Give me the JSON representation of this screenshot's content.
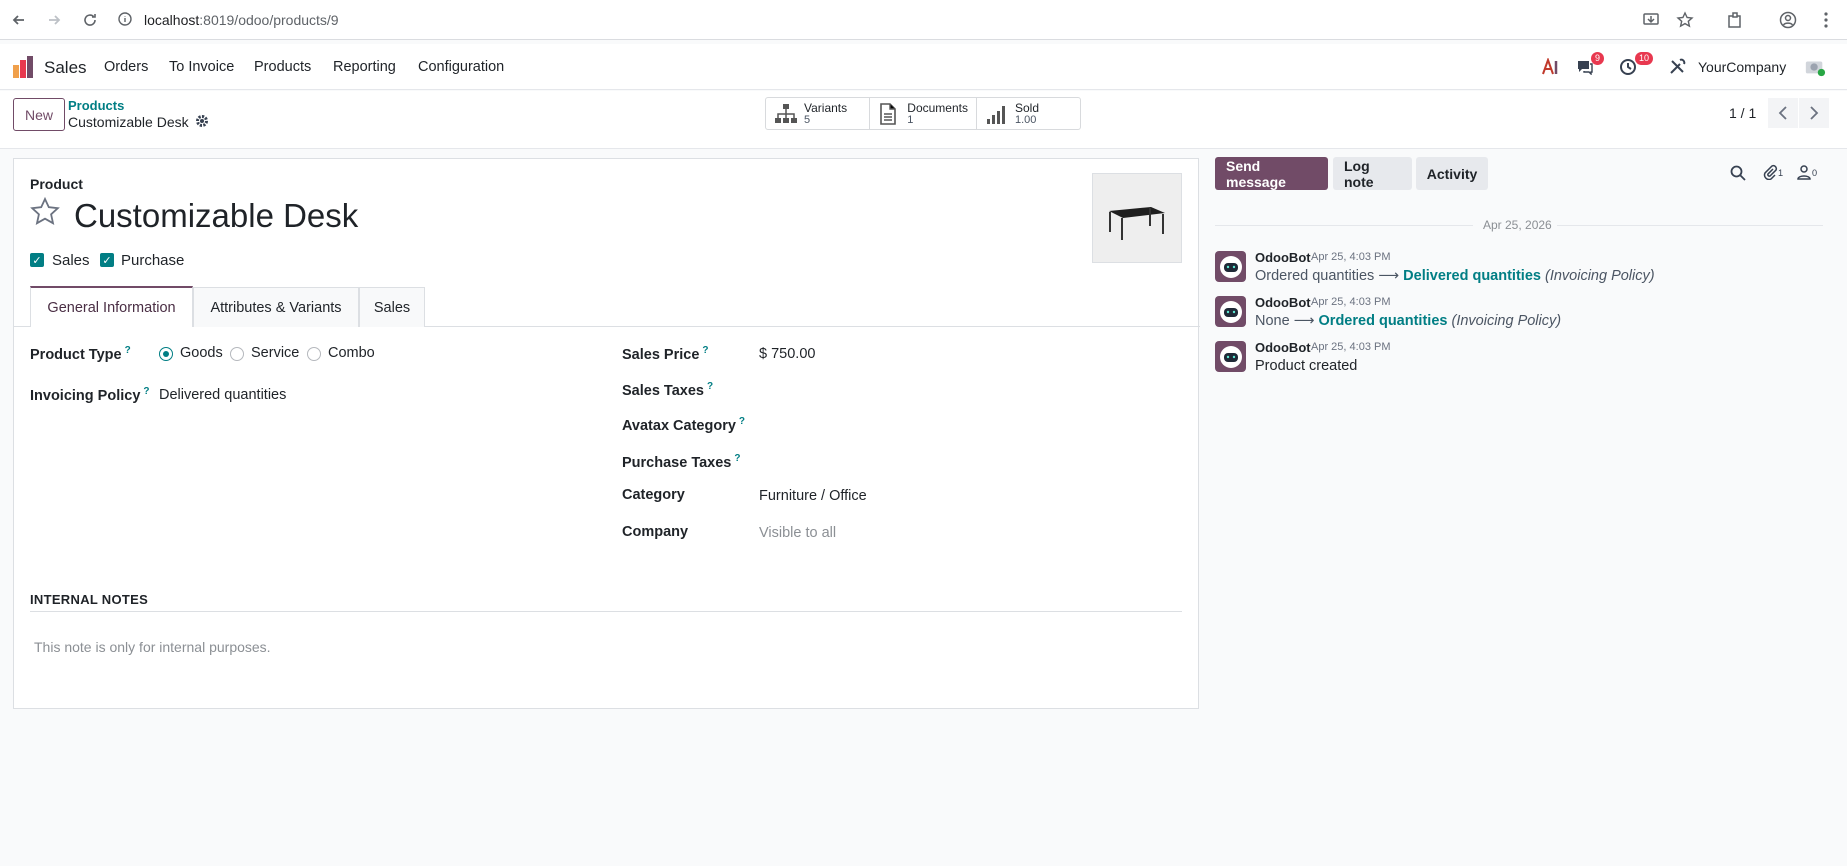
{
  "browser": {
    "url_host": "localhost",
    "url_rest": ":8019/odoo/products/9"
  },
  "navbar": {
    "app_name": "Sales",
    "menu": [
      "Orders",
      "To Invoice",
      "Products",
      "Reporting",
      "Configuration"
    ],
    "messages_badge": "9",
    "activities_badge": "10",
    "company": "YourCompany"
  },
  "control_panel": {
    "new_label": "New",
    "breadcrumb_parent": "Products",
    "breadcrumb_current": "Customizable Desk",
    "stats": [
      {
        "label": "Variants",
        "value": "5",
        "icon": "sitemap-icon"
      },
      {
        "label": "Documents",
        "value": "1",
        "icon": "document-icon"
      },
      {
        "label": "Sold",
        "value": "1.00",
        "icon": "bar-chart-icon"
      }
    ],
    "pager": "1 / 1"
  },
  "form": {
    "product_label": "Product",
    "title": "Customizable Desk",
    "checkboxes": [
      {
        "label": "Sales",
        "checked": true
      },
      {
        "label": "Purchase",
        "checked": true
      }
    ],
    "tabs": [
      "General Information",
      "Attributes & Variants",
      "Sales"
    ],
    "active_tab": "General Information",
    "left_fields": {
      "product_type_label": "Product Type",
      "product_type_options": [
        "Goods",
        "Service",
        "Combo"
      ],
      "product_type_selected": "Goods",
      "invoicing_policy_label": "Invoicing Policy",
      "invoicing_policy_value": "Delivered quantities"
    },
    "right_fields": {
      "sales_price_label": "Sales Price",
      "sales_price_value": "$ 750.00",
      "sales_taxes_label": "Sales Taxes",
      "avatax_label": "Avatax Category",
      "purchase_taxes_label": "Purchase Taxes",
      "category_label": "Category",
      "category_value": "Furniture / Office",
      "company_label": "Company",
      "company_value": "Visible to all"
    },
    "help_mark": "?",
    "notes_heading": "INTERNAL NOTES",
    "notes_placeholder": "This note is only for internal purposes."
  },
  "chatter": {
    "send_message": "Send message",
    "log_note": "Log note",
    "activity": "Activity",
    "attachments_count": "1",
    "followers_count": "0",
    "date_separator": "Apr 25, 2026",
    "messages": [
      {
        "author": "OdooBot",
        "date": "Apr 25, 4:03 PM",
        "old": "Ordered quantities",
        "new": "Delivered quantities",
        "field": "(Invoicing Policy)"
      },
      {
        "author": "OdooBot",
        "date": "Apr 25, 4:03 PM",
        "old": "None",
        "new": "Ordered quantities",
        "field": "(Invoicing Policy)"
      },
      {
        "author": "OdooBot",
        "date": "Apr 25, 4:03 PM",
        "body": "Product created"
      }
    ],
    "arrow": "⟶"
  },
  "colors": {
    "brand": "#714b67",
    "accent": "#017e84",
    "badge": "#e8384f"
  }
}
